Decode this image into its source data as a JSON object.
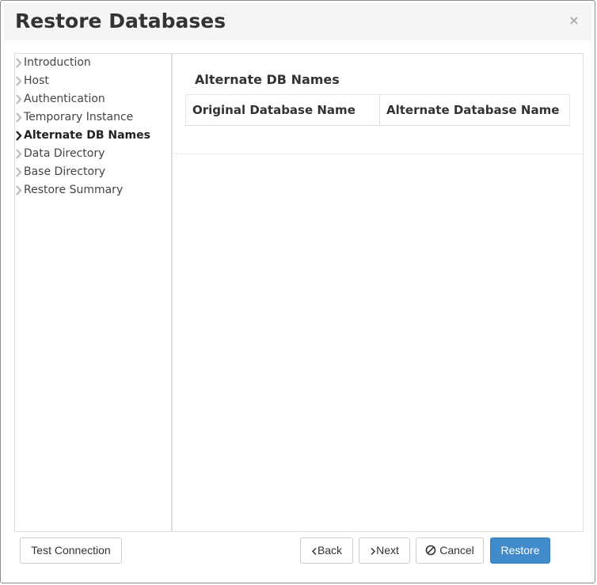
{
  "dialog": {
    "title": "Restore Databases",
    "close_symbol": "×"
  },
  "steps": [
    {
      "label": "Introduction",
      "active": false,
      "icon": "chevron-right-icon"
    },
    {
      "label": "Host",
      "active": false,
      "icon": "chevron-right-icon"
    },
    {
      "label": "Authentication",
      "active": false,
      "icon": "chevron-right-icon"
    },
    {
      "label": "Temporary Instance",
      "active": false,
      "icon": "chevron-right-icon"
    },
    {
      "label": "Alternate DB Names",
      "active": true,
      "icon": "chevron-right-icon"
    },
    {
      "label": "Data Directory",
      "active": false,
      "icon": "chevron-right-icon"
    },
    {
      "label": "Base Directory",
      "active": false,
      "icon": "chevron-right-icon"
    },
    {
      "label": "Restore Summary",
      "active": false,
      "icon": "chevron-right-icon"
    }
  ],
  "main": {
    "section_title": "Alternate DB Names",
    "table": {
      "columns": [
        "Original Database Name",
        "Alternate Database Name"
      ],
      "rows": []
    }
  },
  "footer": {
    "test_connection": "Test Connection",
    "back": "Back",
    "next": "Next",
    "cancel": "Cancel",
    "restore": "Restore"
  },
  "colors": {
    "primary": "#428bca",
    "header_bg": "#f5f5f5",
    "border": "#dddddd"
  }
}
